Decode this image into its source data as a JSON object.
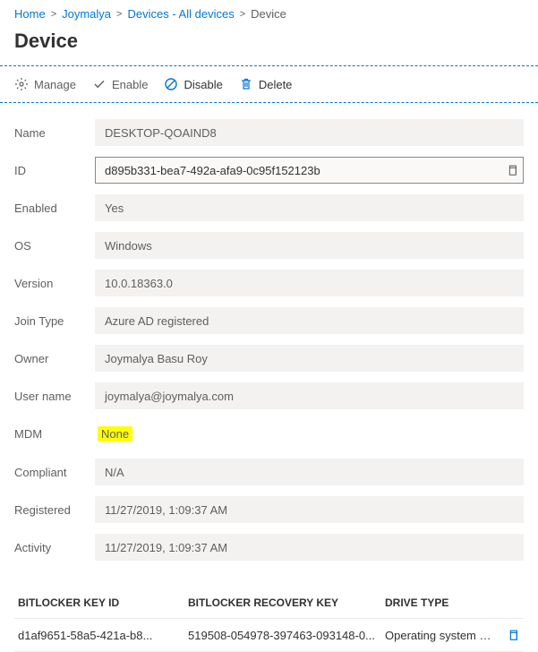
{
  "breadcrumb": {
    "items": [
      {
        "label": "Home"
      },
      {
        "label": "Joymalya"
      },
      {
        "label": "Devices - All devices"
      }
    ],
    "current": "Device"
  },
  "page": {
    "title": "Device"
  },
  "toolbar": {
    "manage": "Manage",
    "enable": "Enable",
    "disable": "Disable",
    "delete": "Delete"
  },
  "fields": {
    "name": {
      "label": "Name",
      "value": "DESKTOP-QOAIND8"
    },
    "id": {
      "label": "ID",
      "value": "d895b331-bea7-492a-afa9-0c95f152123b"
    },
    "enabled": {
      "label": "Enabled",
      "value": "Yes"
    },
    "os": {
      "label": "OS",
      "value": "Windows"
    },
    "version": {
      "label": "Version",
      "value": "10.0.18363.0"
    },
    "join_type": {
      "label": "Join Type",
      "value": "Azure AD registered"
    },
    "owner": {
      "label": "Owner",
      "value": "Joymalya Basu Roy"
    },
    "user_name": {
      "label": "User name",
      "value": "joymalya@joymalya.com"
    },
    "mdm": {
      "label": "MDM",
      "value": "None"
    },
    "compliant": {
      "label": "Compliant",
      "value": "N/A"
    },
    "registered": {
      "label": "Registered",
      "value": "11/27/2019, 1:09:37 AM"
    },
    "activity": {
      "label": "Activity",
      "value": "11/27/2019, 1:09:37 AM"
    }
  },
  "bitlocker": {
    "columns": {
      "key_id": "BitLocker Key ID",
      "recovery_key": "BitLocker Recovery Key",
      "drive_type": "Drive Type"
    },
    "rows": [
      {
        "key_id": "d1af9651-58a5-421a-b8...",
        "recovery_key": "519508-054978-397463-093148-0...",
        "drive_type": "Operating system drive"
      }
    ]
  }
}
